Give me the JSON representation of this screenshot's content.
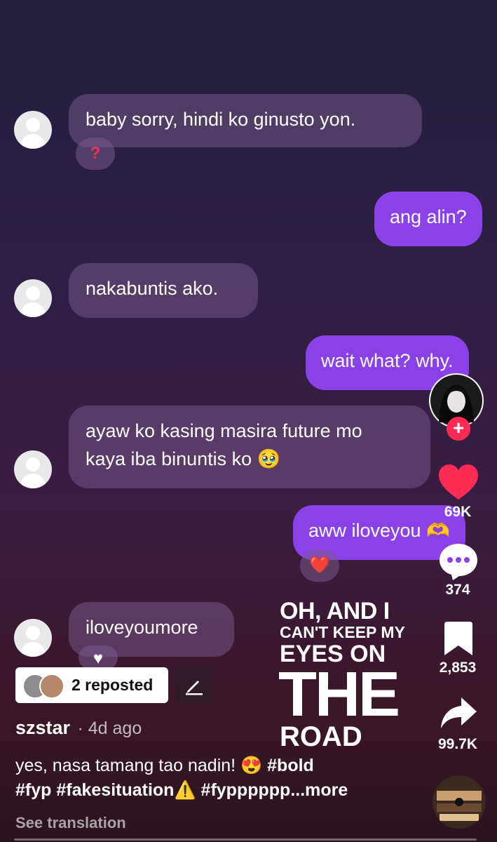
{
  "messages": [
    {
      "text": "baby sorry, hindi ko ginusto yon."
    },
    {
      "text": "ang alin?"
    },
    {
      "text": "nakabuntis ako."
    },
    {
      "text": "wait what? why."
    },
    {
      "line1": "ayaw ko kasing masira future mo",
      "line2": "kaya iba binuntis ko",
      "emoji": "🥹"
    },
    {
      "text": "aww iloveyou",
      "emoji": "🫶"
    },
    {
      "text": "iloveyoumore"
    }
  ],
  "reactions": {
    "question": "?",
    "heart_red": "❤️",
    "heart_white": "♥"
  },
  "overlay": {
    "line1": "OH, AND I",
    "line2": "CAN'T KEEP MY",
    "line3": "EYES ON",
    "line4": "THE",
    "line5": "ROAD"
  },
  "sidebar": {
    "follow_plus": "+",
    "likes": "69K",
    "comments": "374",
    "saves": "2,853",
    "shares": "99.7K"
  },
  "repost": {
    "label": "2 reposted"
  },
  "post": {
    "username": "szstar",
    "time": "· 4d ago",
    "caption_line1": "yes, nasa tamang tao nadin!",
    "caption_emoji1": "😍",
    "caption_tag1": "#bold",
    "caption_line2_tags": "#fyp #fakesituation",
    "caption_emoji2": "⚠️",
    "caption_line2_end": "#fypppppp",
    "more": "...more",
    "see_translation": "See translation"
  },
  "colors": {
    "accent": "#8a41e8",
    "like": "#fe2c55"
  }
}
